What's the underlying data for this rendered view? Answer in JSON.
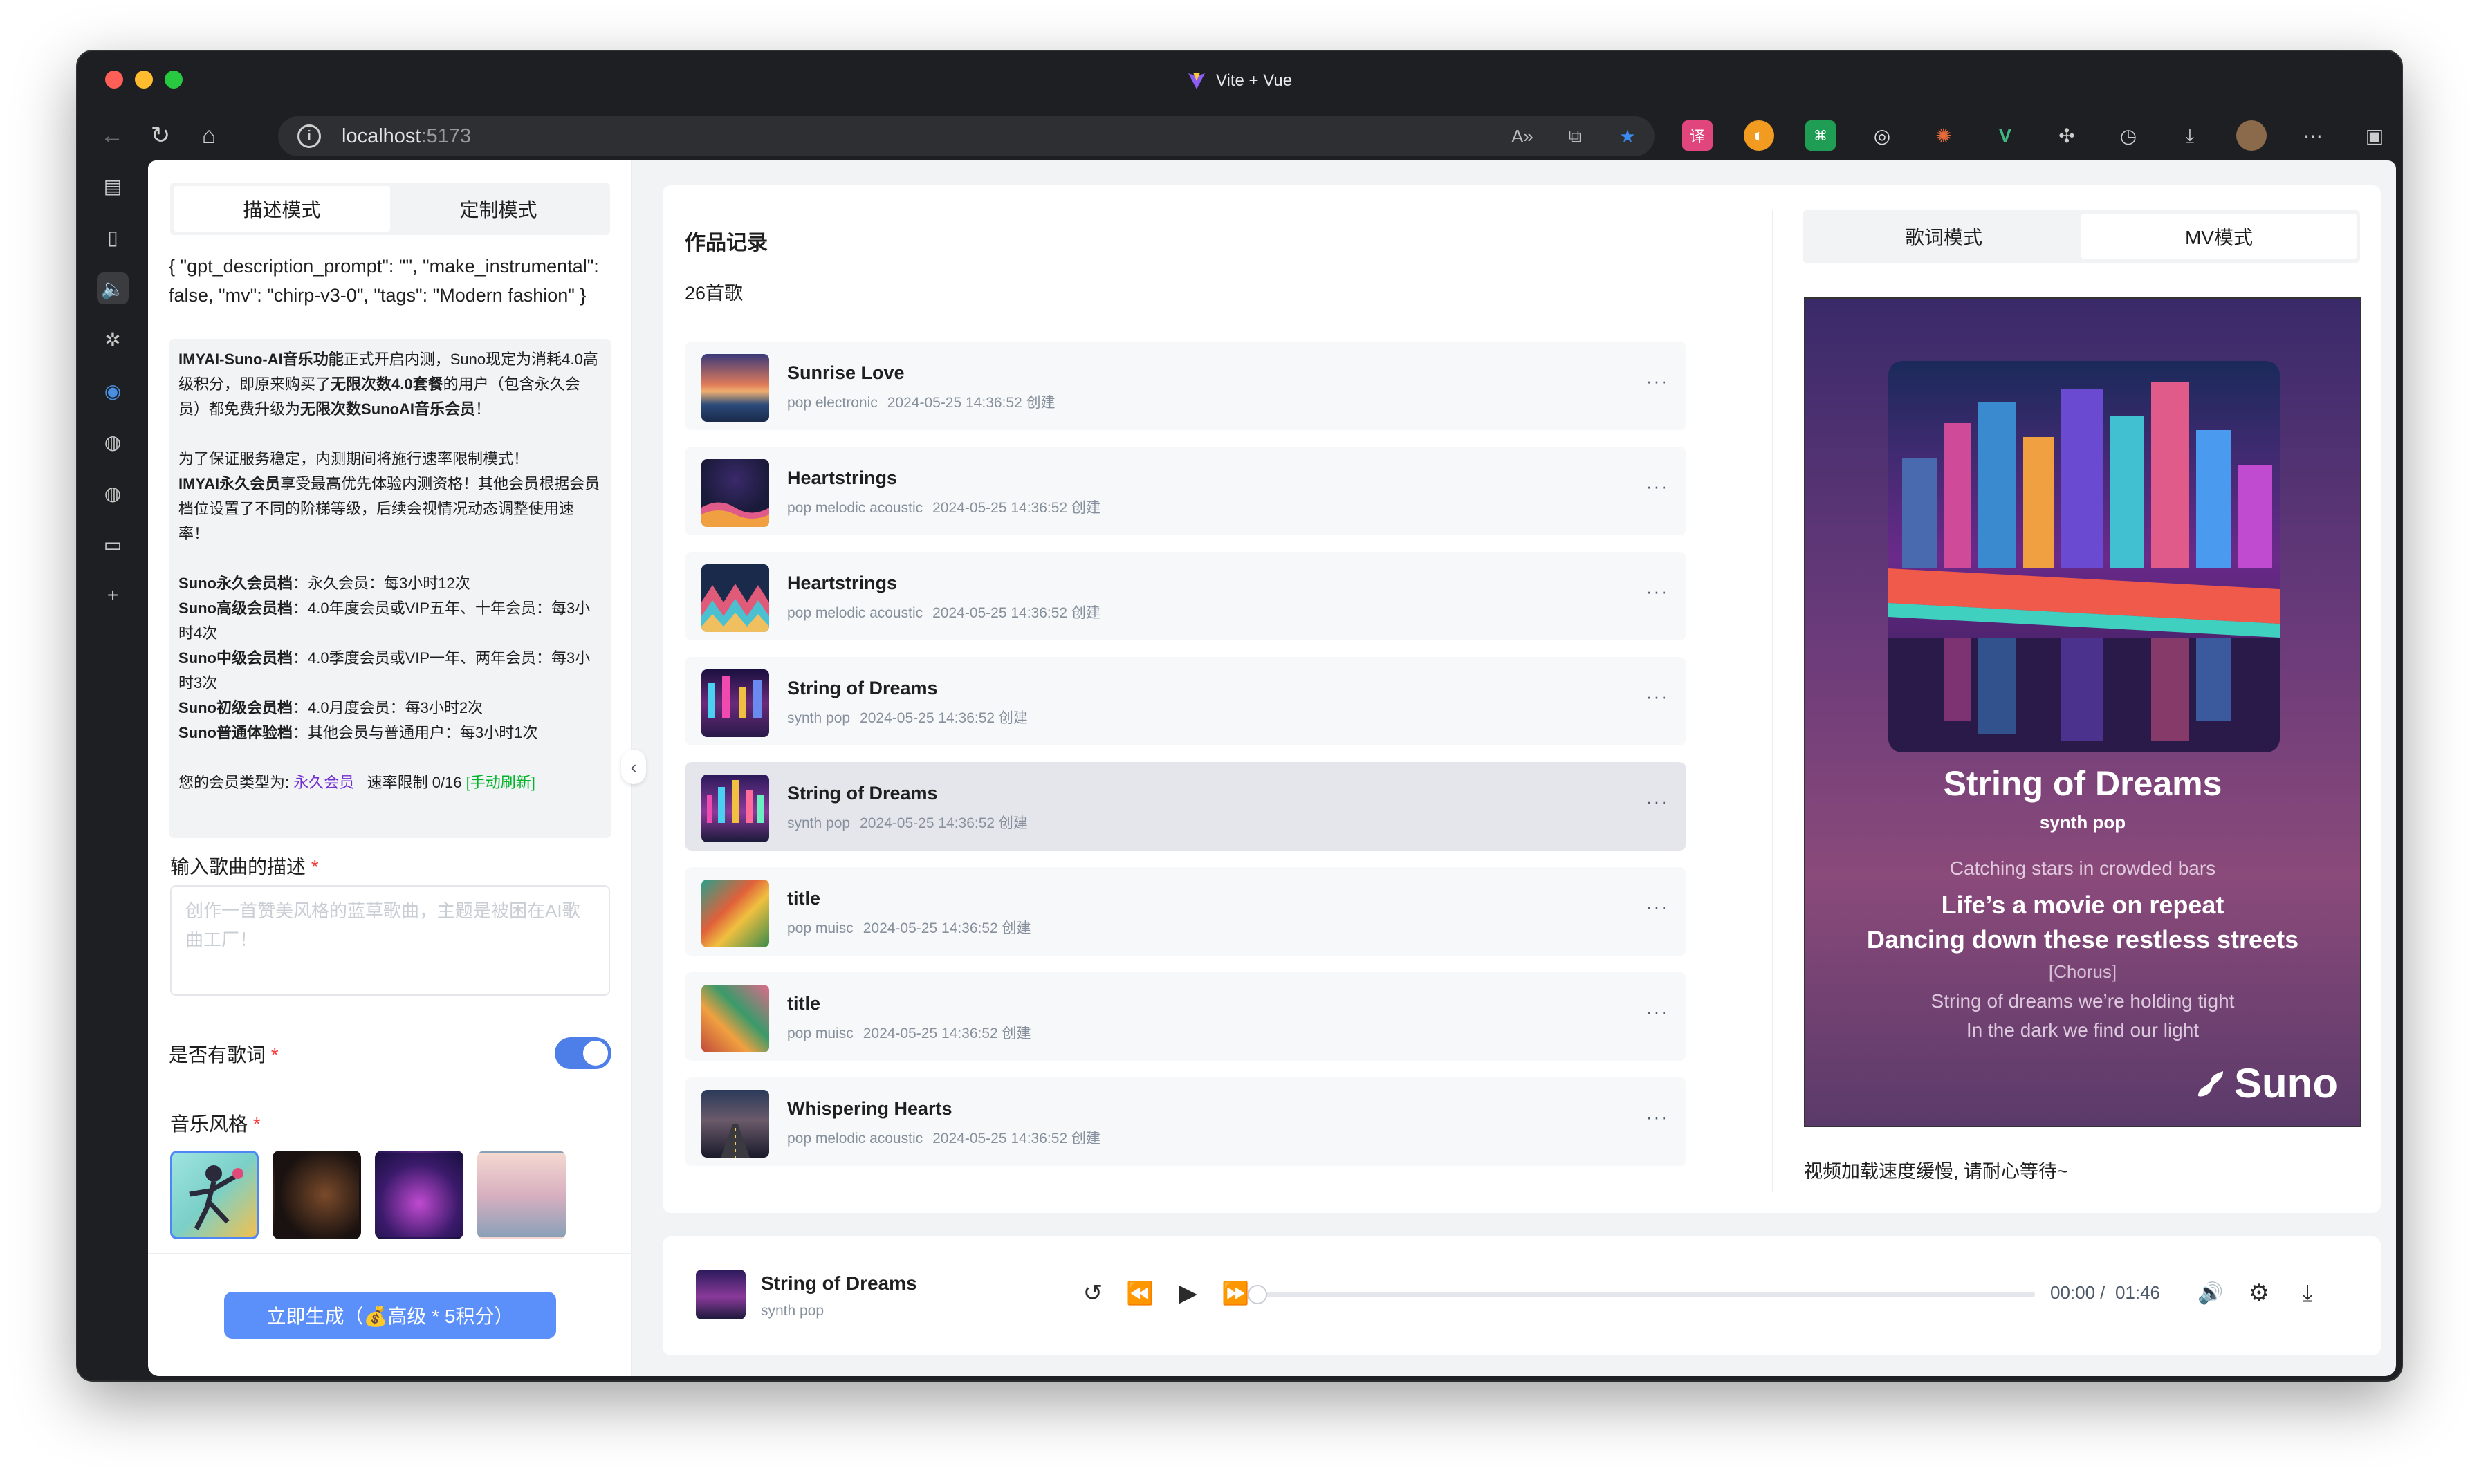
{
  "window": {
    "title": "Vite + Vue"
  },
  "browser": {
    "url_host": "localhost",
    "url_port": ":5173"
  },
  "left": {
    "tabs": [
      "描述模式",
      "定制模式"
    ],
    "json_text": "{ \"gpt_description_prompt\": \"\", \"make_instrumental\": false, \"mv\": \"chirp-v3-0\", \"tags\": \"Modern fashion\" }",
    "notice": {
      "p1_b1": "IMYAI-Suno-AI音乐功能",
      "p1_t1": "正式开启内测，Suno现定为消耗4.0高级积分，即原来购买了",
      "p1_b2": "无限次数4.0套餐",
      "p1_t2": "的用户（包含永久会员）都免费升级为",
      "p1_b3": "无限次数SunoAI音乐会员",
      "p1_t3": "！",
      "p2_t1": "为了保证服务稳定，内测期间将施行速率限制模式！",
      "p2_b1": "IMYAI永久会员",
      "p2_t2": "享受最高优先体验内测资格！其他会员根据会员档位设置了不同的阶梯等级，后续会视情况动态调整使用速率！",
      "tiers": [
        {
          "name": "Suno永久会员档",
          "desc": "：永久会员：每3小时12次"
        },
        {
          "name": "Suno高级会员档",
          "desc": "：4.0年度会员或VIP五年、十年会员：每3小时4次"
        },
        {
          "name": "Suno中级会员档",
          "desc": "：4.0季度会员或VIP一年、两年会员：每3小时3次"
        },
        {
          "name": "Suno初级会员档",
          "desc": "：4.0月度会员：每3小时2次"
        },
        {
          "name": "Suno普通体验档",
          "desc": "：其他会员与普通用户：每3小时1次"
        }
      ],
      "member_label": "您的会员类型为: ",
      "member_type": "永久会员",
      "rate_label": "速率限制 0/16",
      "refresh": "[手动刷新]"
    },
    "desc_label": "输入歌曲的描述",
    "desc_placeholder": "创作一首赞美风格的蓝草歌曲，主题是被困在AI歌曲工厂！",
    "lyrics_label": "是否有歌词",
    "lyrics_on": true,
    "style_label": "音乐风格",
    "required_mark": "*",
    "generate_button": "立即生成（💰高级 * 5积分）"
  },
  "records": {
    "title": "作品记录",
    "count": "26首歌",
    "more": "···",
    "songs": [
      {
        "title": "Sunrise Love",
        "tags": "pop electronic",
        "time": "2024-05-25 14:36:52 创建"
      },
      {
        "title": "Heartstrings",
        "tags": "pop melodic acoustic",
        "time": "2024-05-25 14:36:52 创建"
      },
      {
        "title": "Heartstrings",
        "tags": "pop melodic acoustic",
        "time": "2024-05-25 14:36:52 创建"
      },
      {
        "title": "String of Dreams",
        "tags": "synth pop",
        "time": "2024-05-25 14:36:52 创建"
      },
      {
        "title": "String of Dreams",
        "tags": "synth pop",
        "time": "2024-05-25 14:36:52 创建"
      },
      {
        "title": "title",
        "tags": "pop muisc",
        "time": "2024-05-25 14:36:52 创建"
      },
      {
        "title": "title",
        "tags": "pop muisc",
        "time": "2024-05-25 14:36:52 创建"
      },
      {
        "title": "Whispering Hearts",
        "tags": "pop melodic acoustic",
        "time": "2024-05-25 14:36:52 创建"
      }
    ]
  },
  "right": {
    "tabs": [
      "歌词模式",
      "MV模式"
    ],
    "mv": {
      "title": "String of Dreams",
      "genre": "synth pop",
      "lyrics": [
        "Catching stars in crowded bars",
        "Life’s a movie on repeat",
        "Dancing down these restless streets",
        "[Chorus]",
        "String of dreams we’re holding tight",
        "In the dark we find our light"
      ],
      "brand": "Suno"
    },
    "note": "视频加载速度缓慢, 请耐心等待~"
  },
  "player": {
    "title": "String of Dreams",
    "genre": "synth pop",
    "time": "00:00 /  01:46",
    "progress": 0
  }
}
